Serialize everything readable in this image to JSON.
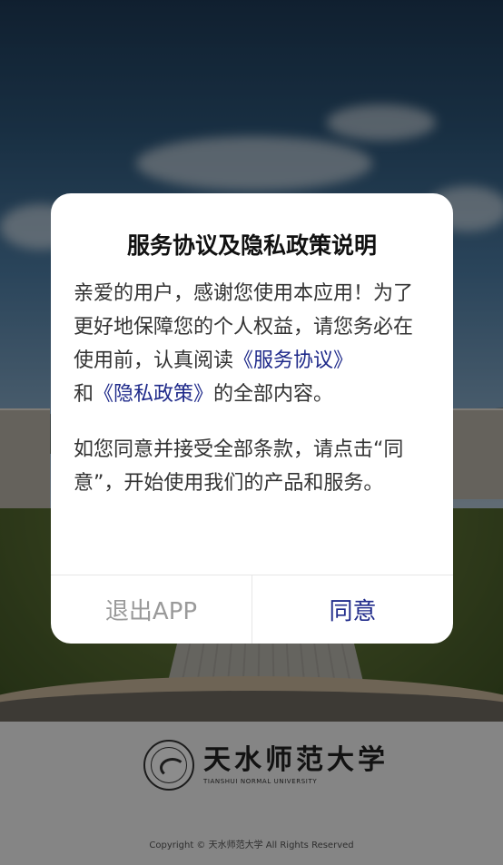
{
  "dialog": {
    "title": "服务协议及隐私政策说明",
    "paragraph1": {
      "text_a": "亲爱的用户，感谢您使用本应用！为了更好地保障您的个人权益，请您务必在使用前，认真阅读",
      "link_service": "《服务协议》",
      "text_b": "和",
      "link_privacy": "《隐私政策》",
      "text_c": "的全部内容。"
    },
    "paragraph2": "如您同意并接受全部条款，请点击“同意”，开始使用我们的产品和服务。",
    "buttons": {
      "exit_label": "退出APP",
      "agree_label": "同意"
    }
  },
  "footer": {
    "logo_cn": "天水师范大学",
    "logo_en": "TIANSHUI NORMAL UNIVERSITY",
    "copyright": "Copyright © 天水师范大学 All Rights Reserved"
  },
  "colors": {
    "link": "#1f2a8a",
    "exit_text": "#9a9a9a",
    "overlay": "rgba(0,0,0,0.45)"
  }
}
